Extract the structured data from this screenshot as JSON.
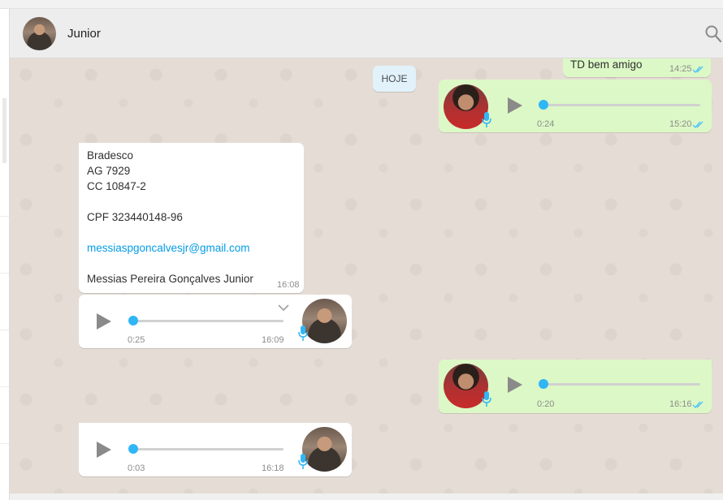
{
  "header": {
    "contact_name": "Junior"
  },
  "chat": {
    "day_label": "HOJE",
    "messages": [
      {
        "type": "text",
        "direction": "out",
        "text": "TD bem amigo",
        "time": "14:25",
        "status": "read"
      },
      {
        "type": "audio",
        "direction": "out",
        "duration": "0:24",
        "time": "15:20",
        "status": "read"
      },
      {
        "type": "text",
        "direction": "in",
        "lines": [
          "Bradesco",
          "AG 7929",
          "CC 10847-2",
          "",
          "CPF 323440148-96",
          "",
          "messiaspgoncalvesjr@gmail.com",
          "",
          "Messias Pereira Gonçalves Junior"
        ],
        "time": "16:08"
      },
      {
        "type": "audio",
        "direction": "in",
        "duration": "0:25",
        "time": "16:09"
      },
      {
        "type": "audio",
        "direction": "out",
        "duration": "0:20",
        "time": "16:16",
        "status": "read"
      },
      {
        "type": "audio",
        "direction": "in",
        "duration": "0:03",
        "time": "16:18"
      }
    ]
  },
  "colors": {
    "incoming": "#ffffff",
    "outgoing": "#dcf8c6",
    "wallpaper": "#e5ddd5",
    "accent": "#30b6f6",
    "read_ticks": "#4fc3f7"
  }
}
